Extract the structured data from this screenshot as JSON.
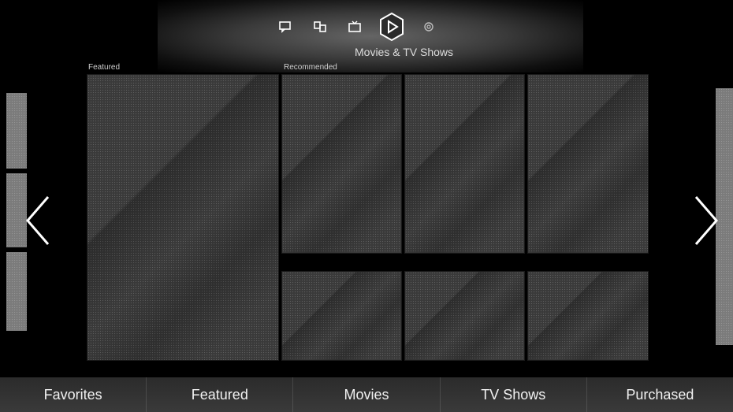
{
  "header": {
    "section_title": "Movies & TV Shows",
    "icons": [
      {
        "name": "chat-icon"
      },
      {
        "name": "multiscreen-icon"
      },
      {
        "name": "tv-icon"
      },
      {
        "name": "play-icon",
        "active": true
      },
      {
        "name": "camera-icon"
      }
    ]
  },
  "grid": {
    "featured_label": "Featured",
    "recommended_label": "Recommended"
  },
  "bottom_nav": {
    "items": [
      "Favorites",
      "Featured",
      "Movies",
      "TV Shows",
      "Purchased"
    ]
  },
  "colors": {
    "background": "#000000",
    "tile": "#3a3a3a",
    "side_panel": "#7b7b7b",
    "text": "#ffffff"
  }
}
